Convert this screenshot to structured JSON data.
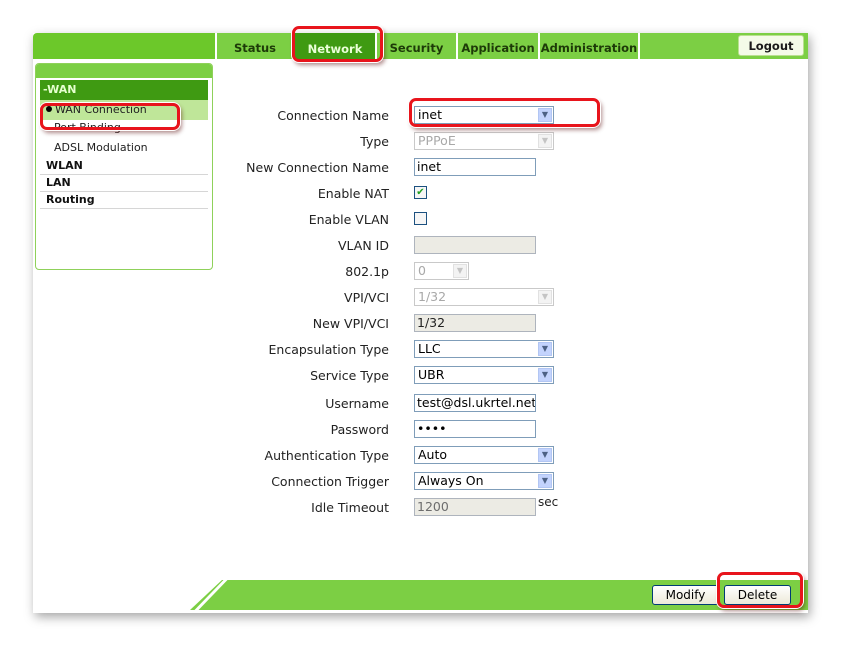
{
  "nav": {
    "tabs": [
      {
        "label": "Status",
        "active": false
      },
      {
        "label": "Network",
        "active": true
      },
      {
        "label": "Security",
        "active": false
      },
      {
        "label": "Application",
        "active": false
      },
      {
        "label": "Administration",
        "active": false
      }
    ],
    "logout_label": "Logout"
  },
  "sidebar": {
    "section": "-WAN",
    "items": [
      {
        "label": "WAN Connection",
        "active": true
      },
      {
        "label": "Port Binding",
        "active": false
      },
      {
        "label": "ADSL Modulation",
        "active": false
      }
    ],
    "groups": [
      "WLAN",
      "LAN",
      "Routing"
    ]
  },
  "form": {
    "connection_name": {
      "label": "Connection Name",
      "value": "inet"
    },
    "type": {
      "label": "Type",
      "value": "PPPoE"
    },
    "new_connection_name": {
      "label": "New Connection Name",
      "value": "inet"
    },
    "enable_nat": {
      "label": "Enable NAT",
      "checked": true
    },
    "enable_vlan": {
      "label": "Enable VLAN",
      "checked": false
    },
    "vlan_id": {
      "label": "VLAN ID",
      "value": ""
    },
    "dot1p": {
      "label": "802.1p",
      "value": "0"
    },
    "vpi_vci": {
      "label": "VPI/VCI",
      "value": "1/32"
    },
    "new_vpi_vci": {
      "label": "New VPI/VCI",
      "value": "1/32"
    },
    "encapsulation_type": {
      "label": "Encapsulation Type",
      "value": "LLC"
    },
    "service_type": {
      "label": "Service Type",
      "value": "UBR"
    },
    "username": {
      "label": "Username",
      "value": "test@dsl.ukrtel.net"
    },
    "password": {
      "label": "Password",
      "value": "••••"
    },
    "authentication_type": {
      "label": "Authentication Type",
      "value": "Auto"
    },
    "connection_trigger": {
      "label": "Connection Trigger",
      "value": "Always On"
    },
    "idle_timeout": {
      "label": "Idle Timeout",
      "value": "1200",
      "unit": "sec"
    }
  },
  "footer": {
    "modify_label": "Modify",
    "delete_label": "Delete"
  },
  "icons": {
    "dropdown_arrow": "⌄",
    "checkmark": "✔",
    "bullet": "●"
  },
  "colors": {
    "brand_green": "#7ccf44",
    "active_green": "#3f9a12",
    "highlight_red": "#e8141c"
  }
}
